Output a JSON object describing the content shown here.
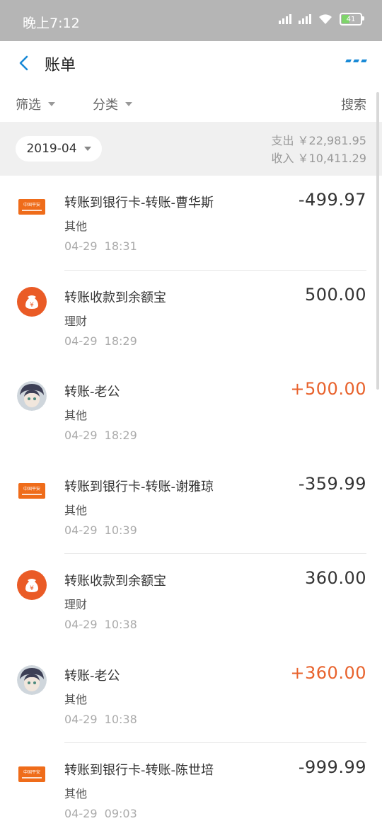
{
  "status_bar": {
    "time": "晚上7:12",
    "battery": "41"
  },
  "header": {
    "title": "账单"
  },
  "filters": {
    "filter_label": "筛选",
    "category_label": "分类",
    "search_label": "搜索"
  },
  "summary": {
    "month": "2019-04",
    "expense": "支出 ￥22,981.95",
    "income": "收入 ￥10,411.29"
  },
  "transactions": [
    {
      "icon": "bank-card-icon",
      "name": "转账到银行卡-转账-曹华斯",
      "category": "其他",
      "time": "04-29  18:31",
      "amount": "-499.97",
      "type": "expense"
    },
    {
      "icon": "yuebao-icon",
      "name": "转账收款到余额宝",
      "category": "理财",
      "time": "04-29  18:29",
      "amount": "500.00",
      "type": "neutral"
    },
    {
      "icon": "avatar-icon",
      "name": "转账-老公",
      "category": "其他",
      "time": "04-29  18:29",
      "amount": "+500.00",
      "type": "income"
    },
    {
      "icon": "bank-card-icon",
      "name": "转账到银行卡-转账-谢雅琼",
      "category": "其他",
      "time": "04-29  10:39",
      "amount": "-359.99",
      "type": "expense"
    },
    {
      "icon": "yuebao-icon",
      "name": "转账收款到余额宝",
      "category": "理财",
      "time": "04-29  10:38",
      "amount": "360.00",
      "type": "neutral"
    },
    {
      "icon": "avatar-icon",
      "name": "转账-老公",
      "category": "其他",
      "time": "04-29  10:38",
      "amount": "+360.00",
      "type": "income"
    },
    {
      "icon": "bank-card-icon",
      "name": "转账到银行卡-转账-陈世培",
      "category": "其他",
      "time": "04-29  09:03",
      "amount": "-999.99",
      "type": "expense"
    }
  ],
  "colors": {
    "accent": "#1a8ad6",
    "income": "#e8622c",
    "bank": "#ef6c1a",
    "yuebao": "#ea5b26",
    "status_bar": "#b5b5b5"
  }
}
